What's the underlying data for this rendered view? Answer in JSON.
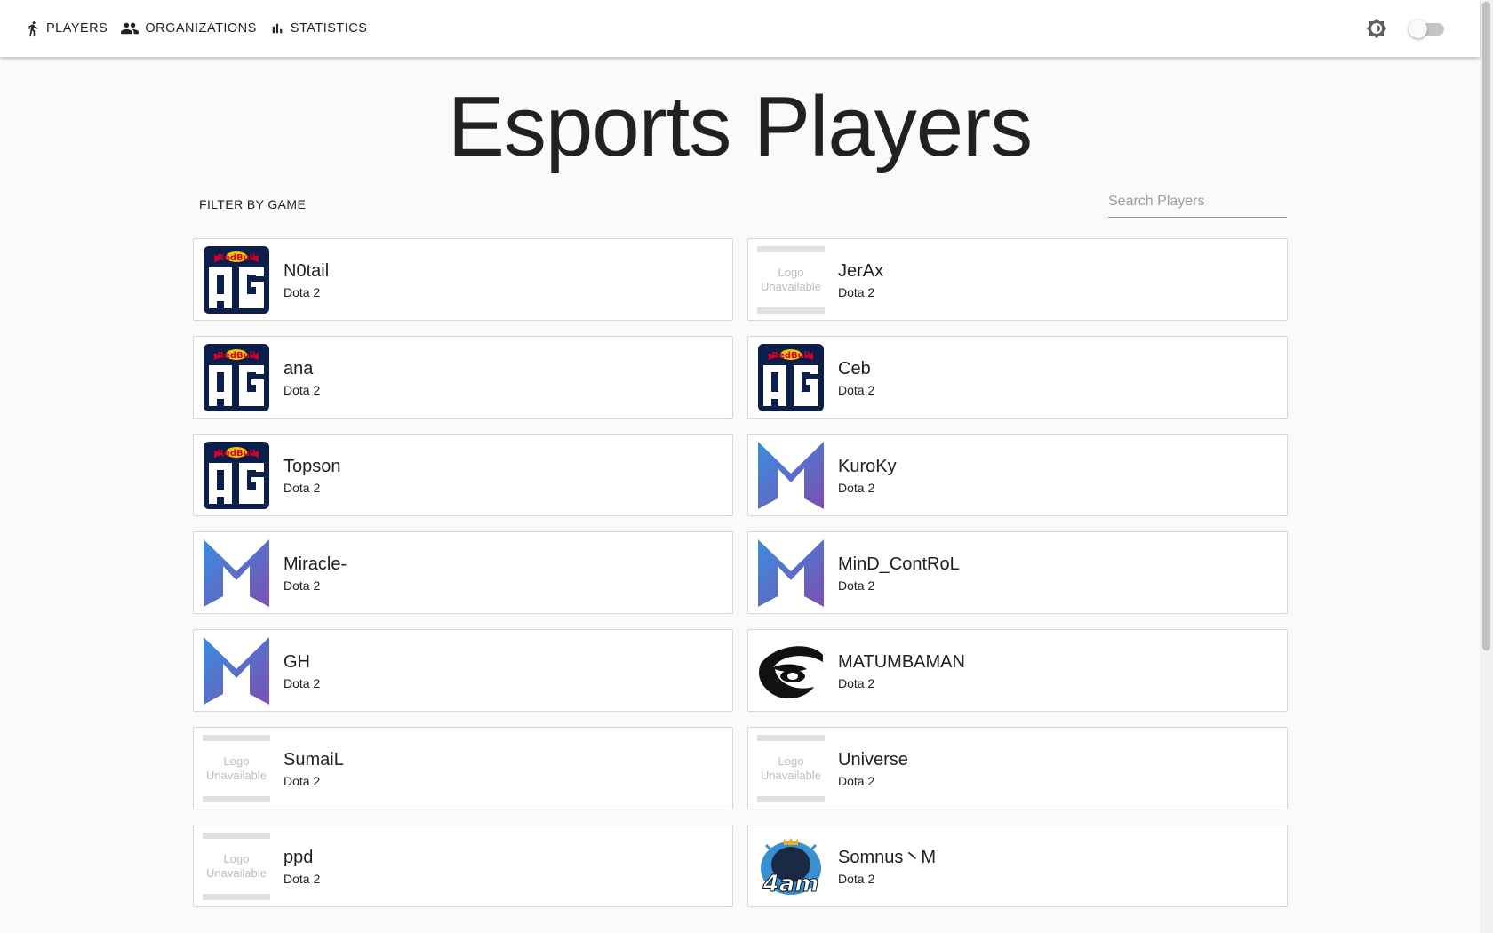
{
  "nav": {
    "players_label": "PLAYERS",
    "organizations_label": "ORGANIZATIONS",
    "statistics_label": "STATISTICS"
  },
  "page": {
    "title": "Esports Players"
  },
  "filter": {
    "label": "FILTER BY GAME"
  },
  "search": {
    "placeholder": "Search Players",
    "value": ""
  },
  "theme_toggle": {
    "on": false
  },
  "logo_unavailable": {
    "line1": "Logo",
    "line2": "Unavailable"
  },
  "players": [
    {
      "name": "N0tail",
      "game": "Dota 2",
      "logo": "og-logo"
    },
    {
      "name": "JerAx",
      "game": "Dota 2",
      "logo": "unavailable"
    },
    {
      "name": "ana",
      "game": "Dota 2",
      "logo": "og-logo"
    },
    {
      "name": "Ceb",
      "game": "Dota 2",
      "logo": "og-logo"
    },
    {
      "name": "Topson",
      "game": "Dota 2",
      "logo": "og-logo"
    },
    {
      "name": "KuroKy",
      "game": "Dota 2",
      "logo": "nigma-logo"
    },
    {
      "name": "Miracle-",
      "game": "Dota 2",
      "logo": "nigma-logo"
    },
    {
      "name": "MinD_ContRoL",
      "game": "Dota 2",
      "logo": "nigma-logo"
    },
    {
      "name": "GH",
      "game": "Dota 2",
      "logo": "nigma-logo"
    },
    {
      "name": "MATUMBAMAN",
      "game": "Dota 2",
      "logo": "secret-logo"
    },
    {
      "name": "SumaiL",
      "game": "Dota 2",
      "logo": "unavailable"
    },
    {
      "name": "Universe",
      "game": "Dota 2",
      "logo": "unavailable"
    },
    {
      "name": "ppd",
      "game": "Dota 2",
      "logo": "unavailable"
    },
    {
      "name": "Somnus丶M",
      "game": "Dota 2",
      "logo": "4am-logo"
    }
  ]
}
